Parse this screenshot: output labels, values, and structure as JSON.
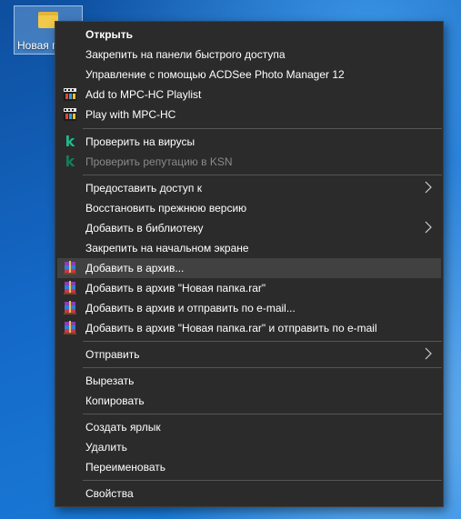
{
  "desktop": {
    "folder_label": "Новая п"
  },
  "menu": {
    "items": [
      {
        "label": "Открыть",
        "bold": true,
        "icon": ""
      },
      {
        "label": "Закрепить на панели быстрого доступа",
        "icon": ""
      },
      {
        "label": "Управление с помощью ACDSee Photo Manager 12",
        "icon": ""
      },
      {
        "label": "Add to MPC-HC Playlist",
        "icon": "mpc-hc-icon"
      },
      {
        "label": "Play with MPC-HC",
        "icon": "mpc-hc-icon"
      },
      {
        "label": "Проверить на вирусы",
        "icon": "kaspersky-icon"
      },
      {
        "label": "Проверить репутацию в KSN",
        "icon": "kaspersky-icon",
        "disabled": true
      },
      {
        "label": "Предоставить доступ к",
        "submenu": true
      },
      {
        "label": "Восстановить прежнюю версию"
      },
      {
        "label": "Добавить в библиотеку",
        "submenu": true
      },
      {
        "label": "Закрепить на начальном экране"
      },
      {
        "label": "Добавить в архив...",
        "icon": "winrar-icon",
        "hover": true
      },
      {
        "label": "Добавить в архив \"Новая папка.rar\"",
        "icon": "winrar-icon"
      },
      {
        "label": "Добавить в архив и отправить по e-mail...",
        "icon": "winrar-icon"
      },
      {
        "label": "Добавить в архив \"Новая папка.rar\" и отправить по e-mail",
        "icon": "winrar-icon"
      },
      {
        "label": "Отправить",
        "submenu": true
      },
      {
        "label": "Вырезать"
      },
      {
        "label": "Копировать"
      },
      {
        "label": "Создать ярлык"
      },
      {
        "label": "Удалить"
      },
      {
        "label": "Переименовать"
      },
      {
        "label": "Свойства"
      }
    ]
  }
}
